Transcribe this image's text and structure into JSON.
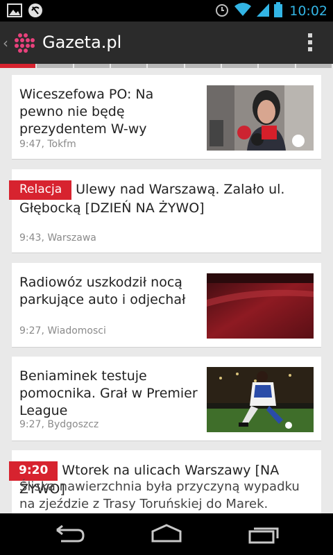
{
  "status_bar": {
    "left_icons": [
      "gallery-icon",
      "sync-icon"
    ],
    "right_icons": [
      "alarm-icon",
      "wifi-icon",
      "signal-icon",
      "battery-icon"
    ],
    "time": "10:02"
  },
  "action_bar": {
    "app_title": "Gazeta.pl",
    "overflow_icon": "overflow-menu-icon"
  },
  "indicator": {
    "segments": 9,
    "active_index": 0
  },
  "feed": [
    {
      "title": "Wiceszefowa PO: Na pewno nie będę prezydentem W-wy",
      "meta": "9:47, Tokfm",
      "badge": "",
      "thumbnail": "press-conference-photo"
    },
    {
      "title": "Ulewy nad Warszawą. Zalało ul. Głębocką [DZIEŃ NA ŻYWO]",
      "meta": "9:43, Warszawa",
      "badge": "Relacja",
      "thumbnail": ""
    },
    {
      "title": "Radiowóz uszkodził nocą parkujące auto i odjechał",
      "meta": "9:27, Wiadomosci",
      "badge": "",
      "thumbnail": "red-car-photo"
    },
    {
      "title": "Beniaminek testuje pomocnika. Grał w Premier League",
      "meta": "9:27, Bydgoszcz",
      "badge": "",
      "thumbnail": "football-player-photo"
    },
    {
      "title": "Wtorek na ulicach Warszawy [NA ŻYWO]",
      "meta": "",
      "badge": "9:20",
      "lead": "Śliska nawierzchnia była przyczyną wypadku na zjeździe z Trasy Toruńskiej do Marek. Kierowca",
      "thumbnail": ""
    }
  ],
  "nav_bar": {
    "buttons": [
      "back-icon",
      "home-icon",
      "recent-apps-icon"
    ]
  },
  "colors": {
    "accent": "#d7232f",
    "time": "#33b5e5",
    "actionbar": "#2b2b2b"
  }
}
